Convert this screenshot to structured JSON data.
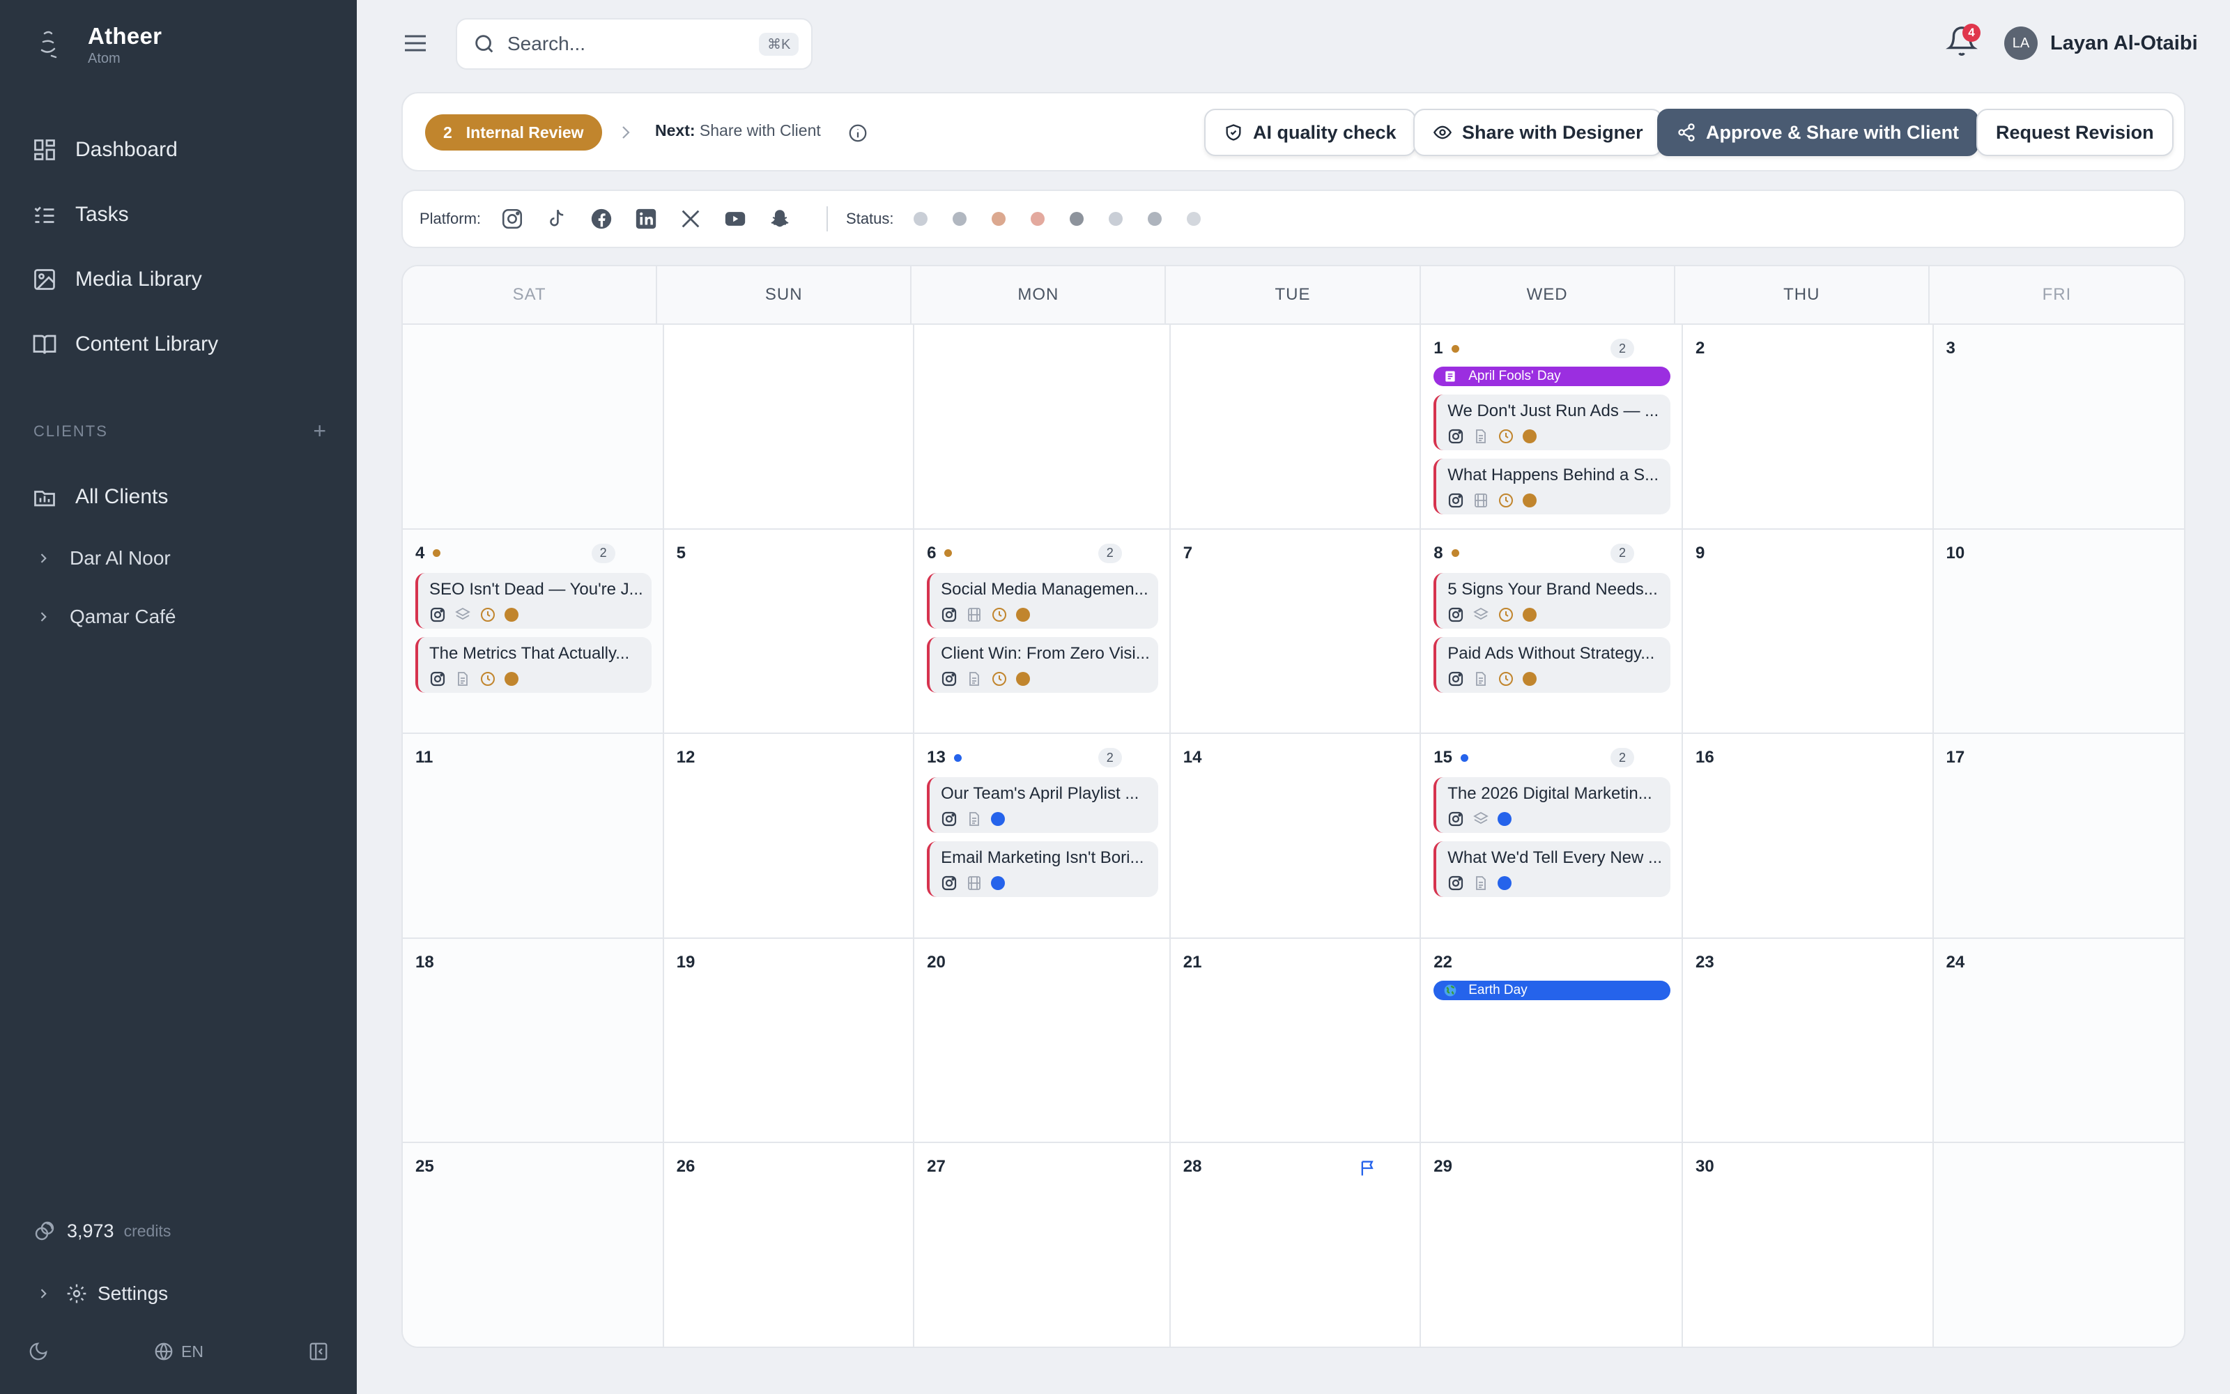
{
  "sidebar": {
    "brand_name": "Atheer",
    "brand_sub": "Atom",
    "nav": [
      {
        "label": "Dashboard",
        "icon": "dashboard-icon"
      },
      {
        "label": "Tasks",
        "icon": "tasks-icon"
      },
      {
        "label": "Media Library",
        "icon": "image-icon"
      },
      {
        "label": "Content Library",
        "icon": "book-icon"
      }
    ],
    "clients_heading": "CLIENTS",
    "clients_add": "+",
    "all_clients": "All Clients",
    "clients": [
      "Dar Al Noor",
      "Qamar Café"
    ],
    "credits_value": "3,973",
    "credits_label": "credits",
    "settings": "Settings",
    "language": "EN"
  },
  "topbar": {
    "search_placeholder": "Search...",
    "search_shortcut": "⌘K",
    "notifications_count": "4",
    "user_initials": "LA",
    "user_name": "Layan Al-Otaibi"
  },
  "review": {
    "stage_number": "2",
    "stage_label": "Internal Review",
    "next_label": "Next:",
    "next_value": "Share with Client",
    "buttons": {
      "ai_check": "AI quality check",
      "share_designer": "Share with Designer",
      "approve": "Approve & Share with Client",
      "revision": "Request Revision"
    }
  },
  "filters": {
    "platform_label": "Platform:",
    "platforms": [
      "instagram-icon",
      "tiktok-icon",
      "facebook-icon",
      "linkedin-icon",
      "x-icon",
      "youtube-icon",
      "snapchat-icon"
    ],
    "status_label": "Status:",
    "status_colors": [
      "#c9ced6",
      "#b1b7c0",
      "#dba88f",
      "#e3a99e",
      "#8d939c",
      "#c9ced6",
      "#aeb4bd",
      "#d3d7dd"
    ]
  },
  "calendar": {
    "weekdays": [
      "SAT",
      "SUN",
      "MON",
      "TUE",
      "WED",
      "THU",
      "FRI"
    ],
    "colors": {
      "amber": "#c1852d",
      "blue": "#2563eb",
      "purple": "#9b2ee0",
      "accent_red": "#d6334e"
    },
    "cells": [
      {
        "day": ""
      },
      {
        "day": ""
      },
      {
        "day": ""
      },
      {
        "day": ""
      },
      {
        "day": "1",
        "dot": "amber",
        "count": "2",
        "event": {
          "label": "April Fools' Day",
          "color": "purple",
          "icon": "note-icon"
        },
        "posts": [
          {
            "title": "We Don't Just Run Ads — ...",
            "format": "document-icon",
            "clock": true,
            "status": "amber"
          },
          {
            "title": "What Happens Behind a S...",
            "format": "film-icon",
            "clock": true,
            "status": "amber"
          }
        ]
      },
      {
        "day": "2"
      },
      {
        "day": "3"
      },
      {
        "day": "4",
        "dot": "amber",
        "count": "2",
        "posts": [
          {
            "title": "SEO Isn't Dead — You're J...",
            "format": "layers-icon",
            "clock": true,
            "status": "amber"
          },
          {
            "title": "The Metrics That Actually...",
            "format": "document-icon",
            "clock": true,
            "status": "amber"
          }
        ]
      },
      {
        "day": "5"
      },
      {
        "day": "6",
        "dot": "amber",
        "count": "2",
        "posts": [
          {
            "title": "Social Media Managemen...",
            "format": "film-icon",
            "clock": true,
            "status": "amber"
          },
          {
            "title": "Client Win: From Zero Visi...",
            "format": "document-icon",
            "clock": true,
            "status": "amber"
          }
        ]
      },
      {
        "day": "7"
      },
      {
        "day": "8",
        "dot": "amber",
        "count": "2",
        "posts": [
          {
            "title": "5 Signs Your Brand Needs...",
            "format": "layers-icon",
            "clock": true,
            "status": "amber"
          },
          {
            "title": "Paid Ads Without Strategy...",
            "format": "document-icon",
            "clock": true,
            "status": "amber"
          }
        ]
      },
      {
        "day": "9"
      },
      {
        "day": "10"
      },
      {
        "day": "11"
      },
      {
        "day": "12"
      },
      {
        "day": "13",
        "dot": "blue",
        "count": "2",
        "posts": [
          {
            "title": "Our Team's April Playlist ...",
            "format": "document-icon",
            "clock": false,
            "status": "blue"
          },
          {
            "title": "Email Marketing Isn't Bori...",
            "format": "film-icon",
            "clock": false,
            "status": "blue"
          }
        ]
      },
      {
        "day": "14"
      },
      {
        "day": "15",
        "dot": "blue",
        "count": "2",
        "posts": [
          {
            "title": "The 2026 Digital Marketin...",
            "format": "layers-icon",
            "clock": false,
            "status": "blue"
          },
          {
            "title": "What We'd Tell Every New ...",
            "format": "document-icon",
            "clock": false,
            "status": "blue"
          }
        ]
      },
      {
        "day": "16"
      },
      {
        "day": "17"
      },
      {
        "day": "18"
      },
      {
        "day": "19"
      },
      {
        "day": "20"
      },
      {
        "day": "21"
      },
      {
        "day": "22",
        "event": {
          "label": "Earth Day",
          "color": "blue",
          "icon": "globe-icon"
        }
      },
      {
        "day": "23"
      },
      {
        "day": "24"
      },
      {
        "day": "25"
      },
      {
        "day": "26"
      },
      {
        "day": "27"
      },
      {
        "day": "28",
        "flag": true
      },
      {
        "day": "29"
      },
      {
        "day": "30"
      },
      {
        "day": ""
      }
    ]
  }
}
